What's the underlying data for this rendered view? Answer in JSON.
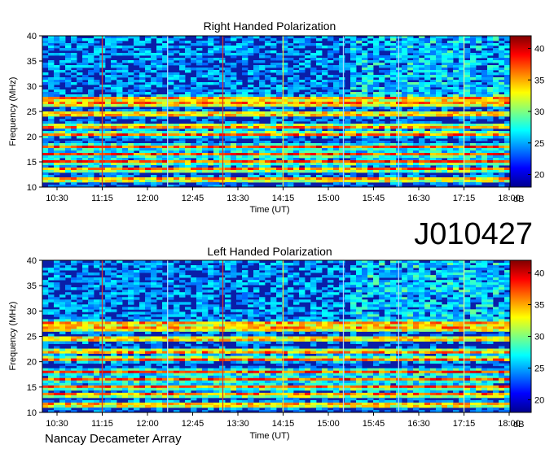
{
  "chart_data": [
    {
      "type": "heatmap",
      "title": "Right Handed Polarization",
      "xlabel": "Time (UT)",
      "ylabel": "Frequency (MHz)",
      "x_ticks": [
        "10:30",
        "11:15",
        "12:00",
        "12:45",
        "13:30",
        "14:15",
        "15:00",
        "15:45",
        "16:30",
        "17:15",
        "18:00"
      ],
      "y_ticks": [
        10,
        15,
        20,
        25,
        30,
        35,
        40
      ],
      "ylim": [
        10,
        40
      ],
      "colorbar": {
        "label": "dB",
        "ticks": [
          20,
          25,
          30,
          35,
          40
        ],
        "range": [
          18,
          42
        ],
        "colormap": "jet"
      },
      "intense_bands_mhz": [
        11.5,
        13.5,
        15,
        16.5,
        18,
        20.5,
        22,
        24.5,
        26.5,
        27.5
      ],
      "markers": [
        {
          "time": "11:15",
          "color": "#d43a2a"
        },
        {
          "time": "12:20",
          "color": "#a8d8ff"
        },
        {
          "time": "13:15",
          "color": "#d43a2a"
        },
        {
          "time": "14:15",
          "color": "#f0e040"
        },
        {
          "time": "15:15",
          "color": "#a8d8ff"
        },
        {
          "time": "16:10",
          "color": "#a8d8ff"
        },
        {
          "time": "17:15",
          "color": "#e0f4a0"
        }
      ]
    },
    {
      "type": "heatmap",
      "title": "Left Handed Polarization",
      "xlabel": "Time (UT)",
      "ylabel": "Frequency (MHz)",
      "x_ticks": [
        "10:30",
        "11:15",
        "12:00",
        "12:45",
        "13:30",
        "14:15",
        "15:00",
        "15:45",
        "16:30",
        "17:15",
        "18:00"
      ],
      "y_ticks": [
        10,
        15,
        20,
        25,
        30,
        35,
        40
      ],
      "ylim": [
        10,
        40
      ],
      "colorbar": {
        "label": "dB",
        "ticks": [
          20,
          25,
          30,
          35,
          40
        ],
        "range": [
          18,
          42
        ],
        "colormap": "jet"
      },
      "intense_bands_mhz": [
        11.5,
        13.5,
        15,
        16.5,
        18,
        20.5,
        22,
        24.5,
        26.5,
        27.5
      ],
      "markers": [
        {
          "time": "11:15",
          "color": "#d43a2a"
        },
        {
          "time": "12:20",
          "color": "#a8d8ff"
        },
        {
          "time": "13:15",
          "color": "#d43a2a"
        },
        {
          "time": "14:15",
          "color": "#f0e040"
        },
        {
          "time": "15:15",
          "color": "#a8d8ff"
        },
        {
          "time": "16:10",
          "color": "#a8d8ff"
        },
        {
          "time": "17:15",
          "color": "#e0f4a0"
        }
      ]
    }
  ],
  "observation_id": "J010427",
  "credit": "Nancay Decameter Array"
}
